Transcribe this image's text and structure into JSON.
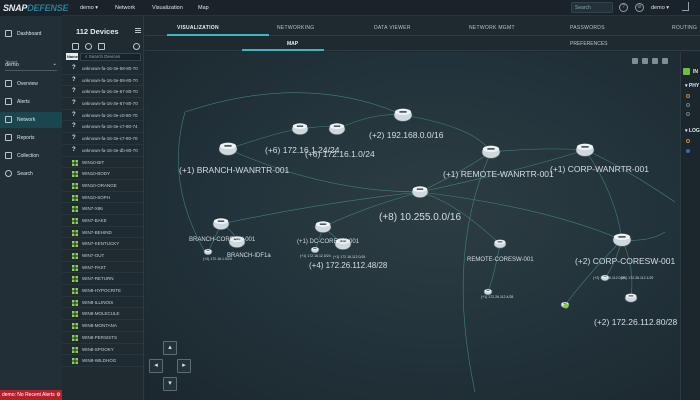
{
  "brand": {
    "logo_part1": "SNAP",
    "logo_part2": "DEFENSE"
  },
  "topbar": {
    "tenant": "demo",
    "menu": [
      "Network",
      "Visualization",
      "Map"
    ],
    "search_placeholder": "Search",
    "user": "demo"
  },
  "nav": {
    "dashboard": "Dashboard",
    "tenant_label": "Tenant",
    "tenant_value": "demo",
    "items": [
      "Overview",
      "Alerts",
      "Network",
      "Reports",
      "Collection",
      "Search"
    ]
  },
  "alertbar": {
    "text": "demo: No Recent Alerts"
  },
  "devices": {
    "count_label": "112 Devices",
    "sort_label": "Name",
    "search_placeholder": "Search Devices",
    "list": [
      "unknown-fa-16-3e-58-80-70",
      "unknown-fa-16-3e-59-80-70",
      "unknown-fa-16-3e-67-80-70",
      "unknown-fa-16-3e-67-80-70",
      "unknown-fa-16-3e-c0-80-70",
      "unknown-fa-16-3e-c7-80-74",
      "unknown-fa-16-3e-c7-80-70",
      "unknown-fa-16-3e-db-80-70",
      "WIN10-BIT",
      "WIN10-BODY",
      "WIN10-ORANGE",
      "WIN10-SOPH",
      "WIN7-X86",
      "WIN7-BAKE",
      "WIN7-BEHIND",
      "WIN7-KENTUCKY",
      "WIN7-OUT",
      "WIN7-PAST",
      "WIN7-RETURN",
      "WIN8-HYPOCRITE",
      "WIN8-ILLINOIS",
      "WIN8-MOLECULE",
      "WIN8-MONTANA",
      "WIN8-PERSISTS",
      "WIN8-SPOOKY",
      "WIN8-WILDHOG"
    ]
  },
  "tabs": [
    "VISUALIZATION",
    "NETWORKING",
    "DATA VIEWER",
    "NETWORK MGMT",
    "PASSWORDS",
    "ROUTING"
  ],
  "subtabs": [
    "MAP",
    "PREFERENCES"
  ],
  "rightpanel": {
    "items": [
      "IN",
      "PHY",
      "LOG"
    ]
  },
  "map": {
    "labels": {
      "branch_wanrtr": "(+1) BRANCH-WANRTR-001",
      "cloud_172_16_1": "(+6) 172.16.1.24/24",
      "cloud_172_16_1b": "(+6) 172.16.1.0/24",
      "cloud_192": "(+2) 192.168.0.0/16",
      "remote_wanrtr": "(+1) REMOTE-WANRTR-001",
      "corp_wanrtr": "(+1) CORP-WANRTR-001",
      "core_10": "(+8) 10.255.0.0/16",
      "branch_coresw": "BRANCH-CORESW-001",
      "branch_idf": "BRANCH-IDF1a",
      "dc_coresw": "(+1) DC-CORESW-001",
      "net_172_26_112_48": "(+4) 172.26.112.48/28",
      "remote_coresw": "REMOTE-CORESW-001",
      "corp_coresw": "(+2) CORP-CORESW-001",
      "net_172_26_112_80": "(+2) 172.26.112.80/28",
      "small_a": "(+2) 172.16.1.0/24",
      "small_b": "(+1) 172.16.12.0/24",
      "small_c": "(+1) 172.16.112.0/24",
      "small_d": "(+1) 172.26.112.4/28",
      "small_e": "(+2) 172.26.112.0/28",
      "small_f": "(+1) 172.26.112.1/29"
    }
  }
}
